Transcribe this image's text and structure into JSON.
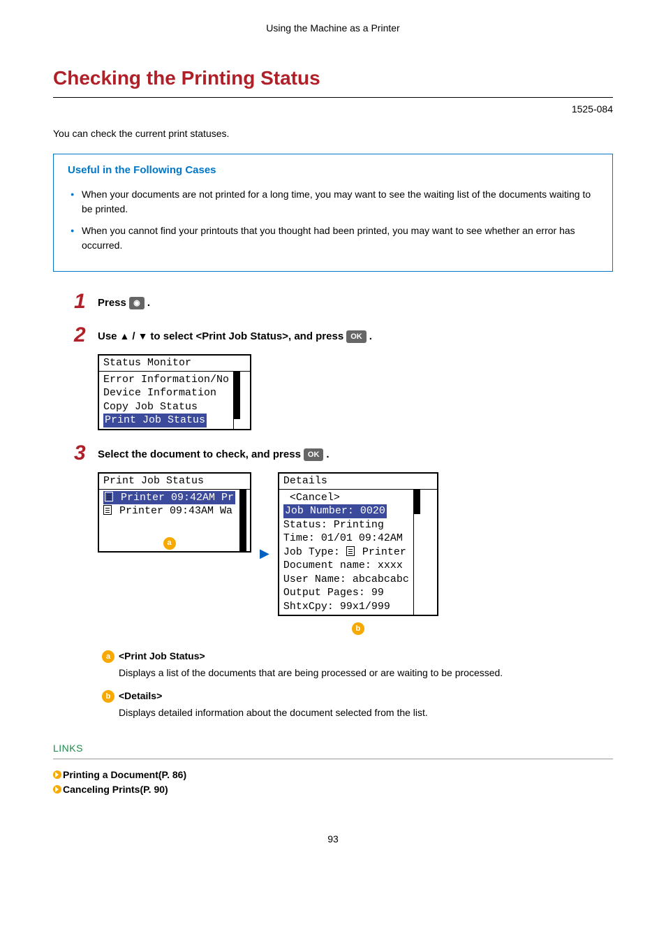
{
  "breadcrumb": "Using the Machine as a Printer",
  "title": "Checking the Printing Status",
  "doc_id": "1525-084",
  "intro": "You can check the current print statuses.",
  "box": {
    "heading": "Useful in the Following Cases",
    "items": [
      "When your documents are not printed for a long time, you may want to see the waiting list of the documents waiting to be printed.",
      "When you cannot find your printouts that you thought had been printed, you may want to see whether an error has occurred."
    ]
  },
  "steps": {
    "s1": {
      "num": "1",
      "prefix": "Press ",
      "key_icon": "◉",
      "suffix": "."
    },
    "s2": {
      "num": "2",
      "prefix": "Use ",
      "mid": " / ",
      "rest": " to select <Print Job Status>, and press ",
      "ok": "OK",
      "suffix": "."
    },
    "s3": {
      "num": "3",
      "prefix": "Select the document to check, and press ",
      "ok": "OK",
      "suffix": "."
    }
  },
  "lcd1": {
    "title": "Status Monitor",
    "l1": "Error Information/No",
    "l2": "Device Information",
    "l3": "Copy Job Status",
    "l4": "Print Job Status"
  },
  "lcd2": {
    "title": "Print Job Status",
    "l1": " Printer 09:42AM Pr",
    "l2": " Printer 09:43AM Wa",
    "callout": "a"
  },
  "lcd3": {
    "title": "Details",
    "l1": " <Cancel>",
    "l2": "Job Number: 0020",
    "l3": "Status: Printing",
    "l4": "Time: 01/01 09:42AM",
    "l5a": "Job Type: ",
    "l5b": " Printer",
    "l6": "Document name: xxxx",
    "l7": "User Name: abcabcabc",
    "l8": "Output Pages: 99",
    "l9": "ShtxCpy: 99x1/999",
    "callout": "b"
  },
  "definitions": {
    "a": {
      "badge": "a",
      "title": "<Print Job Status>",
      "body": "Displays a list of the documents that are being processed or are waiting to be processed."
    },
    "b": {
      "badge": "b",
      "title": "<Details>",
      "body": "Displays detailed information about the document selected from the list."
    }
  },
  "links": {
    "heading": "LINKS",
    "items": [
      "Printing a Document(P. 86)",
      "Canceling Prints(P. 90)"
    ]
  },
  "page_num": "93"
}
